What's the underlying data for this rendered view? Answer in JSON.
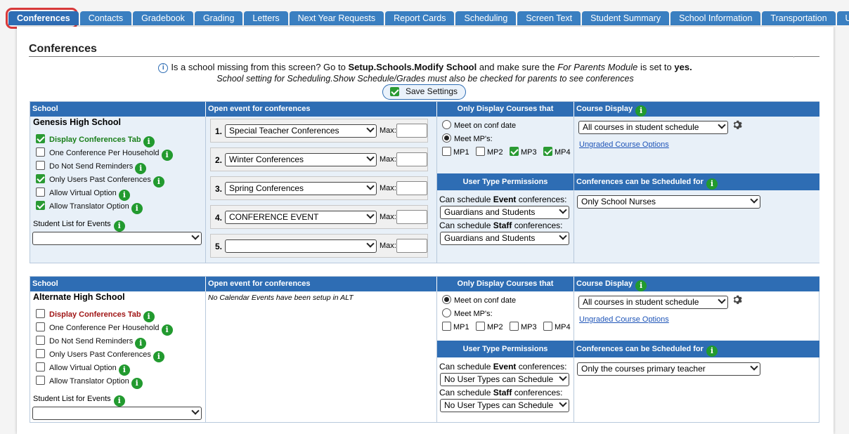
{
  "tabs": [
    {
      "label": "Conferences",
      "active": true
    },
    {
      "label": "Contacts"
    },
    {
      "label": "Gradebook"
    },
    {
      "label": "Grading"
    },
    {
      "label": "Letters"
    },
    {
      "label": "Next Year Requests"
    },
    {
      "label": "Report Cards"
    },
    {
      "label": "Scheduling"
    },
    {
      "label": "Screen Text"
    },
    {
      "label": "Student Summary"
    },
    {
      "label": "School Information"
    },
    {
      "label": "Transportation"
    },
    {
      "label": "U"
    }
  ],
  "page": {
    "title": "Conferences",
    "info_prefix": "Is a school missing from this screen? Go to",
    "info_path": "Setup.Schools.Modify School",
    "info_mid": "and make sure the",
    "info_module": "For Parents Module",
    "info_suffix": "is set to",
    "info_yes": "yes.",
    "info_line2": "School setting for Scheduling.Show Schedule/Grades must also be checked for parents to see conferences",
    "save_label": "Save Settings"
  },
  "headers": {
    "school": "School",
    "open_event": "Open event for conferences",
    "only_display": "Only Display Courses that",
    "course_display": "Course Display",
    "user_type_permissions": "User Type Permissions",
    "scheduled_for": "Conferences can be Scheduled for",
    "student_list": "Student List for Events",
    "max": "Max:",
    "meet_conf_date": "Meet on conf date",
    "meet_mps": "Meet MP's:",
    "ungraded_link": "Ungraded Course Options",
    "can_schedule_prefix": "Can schedule",
    "event_word": "Event",
    "staff_word": "Staff",
    "conferences_suffix": "conferences:"
  },
  "schools": [
    {
      "name": "Genesis High School",
      "options": [
        {
          "label": "Display Conferences Tab",
          "checked": true,
          "info": true,
          "style": "green"
        },
        {
          "label": "One Conference Per Household",
          "checked": false,
          "info": true
        },
        {
          "label": "Do Not Send Reminders",
          "checked": false,
          "info": true
        },
        {
          "label": "Only Users Past Conferences",
          "checked": true,
          "info": true
        },
        {
          "label": "Allow Virtual Option",
          "checked": false,
          "info": true
        },
        {
          "label": "Allow Translator Option",
          "checked": true,
          "info": true
        }
      ],
      "student_list_value": "",
      "events": [
        {
          "num": "1.",
          "value": "Special Teacher Conferences",
          "max": ""
        },
        {
          "num": "2.",
          "value": "Winter Conferences",
          "max": ""
        },
        {
          "num": "3.",
          "value": "Spring Conferences",
          "max": ""
        },
        {
          "num": "4.",
          "value": "CONFERENCE EVENT",
          "max": ""
        },
        {
          "num": "5.",
          "value": "",
          "max": ""
        }
      ],
      "meet_on_conf_date": false,
      "meet_mps": true,
      "mps": [
        {
          "label": "MP1",
          "checked": false
        },
        {
          "label": "MP2",
          "checked": false
        },
        {
          "label": "MP3",
          "checked": true
        },
        {
          "label": "MP4",
          "checked": true
        }
      ],
      "course_display_value": "All courses in student schedule",
      "event_perm_value": "Guardians and Students",
      "staff_perm_value": "Guardians and Students",
      "scheduled_for_value": "Only School Nurses"
    },
    {
      "name": "Alternate High School",
      "options": [
        {
          "label": "Display Conferences Tab",
          "checked": false,
          "info": true,
          "style": "red"
        },
        {
          "label": "One Conference Per Household",
          "checked": false,
          "info": true
        },
        {
          "label": "Do Not Send Reminders",
          "checked": false,
          "info": true
        },
        {
          "label": "Only Users Past Conferences",
          "checked": false,
          "info": true
        },
        {
          "label": "Allow Virtual Option",
          "checked": false,
          "info": true
        },
        {
          "label": "Allow Translator Option",
          "checked": false,
          "info": true
        }
      ],
      "student_list_value": "",
      "no_events_text": "No Calendar Events have been setup in ALT",
      "meet_on_conf_date": true,
      "meet_mps": false,
      "mps": [
        {
          "label": "MP1",
          "checked": false
        },
        {
          "label": "MP2",
          "checked": false
        },
        {
          "label": "MP3",
          "checked": false
        },
        {
          "label": "MP4",
          "checked": false
        }
      ],
      "course_display_value": "All courses in student schedule",
      "event_perm_value": "No User Types can Schedule",
      "staff_perm_value": "No User Types can Schedule",
      "scheduled_for_value": "Only the courses primary teacher"
    }
  ],
  "colors": {
    "header_blue": "#2e6db4",
    "tab_blue": "#3a7fc1",
    "info_green": "#229a2f",
    "highlight_red": "#d8393a"
  }
}
